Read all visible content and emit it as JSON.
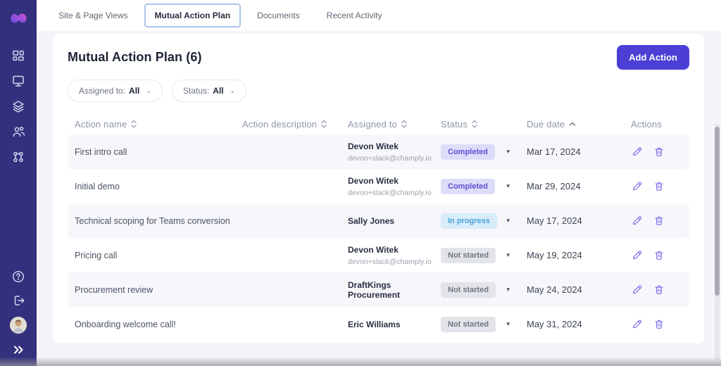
{
  "colors": {
    "sidebar": "#33317d",
    "accent": "#4b3fd6",
    "active_tab_border": "#a9c3ea",
    "row_alt_bg": "#f6f6fb",
    "completed_bg": "#dcddf8",
    "completed_text": "#5a50d6",
    "in_progress_bg": "#d8ecf9",
    "in_progress_text": "#49a3dc",
    "not_started_bg": "#e3e4e9",
    "not_started_text": "#6e7580",
    "action_icon": "#7a6ee8"
  },
  "sidebar": {
    "icons": [
      "app-logo",
      "dashboard-icon",
      "monitor-icon",
      "layers-icon",
      "users-icon",
      "nodes-icon",
      "help-icon",
      "logout-icon",
      "user-avatar",
      "expand-icon"
    ]
  },
  "tabs": [
    {
      "label": "Site & Page Views",
      "active": false
    },
    {
      "label": "Mutual Action Plan",
      "active": true
    },
    {
      "label": "Documents",
      "active": false
    },
    {
      "label": "Recent Activity",
      "active": false
    }
  ],
  "header": {
    "title": "Mutual Action Plan (6)",
    "add_button": "Add Action"
  },
  "filters": {
    "assigned_label": "Assigned to:",
    "assigned_value": "All",
    "status_label": "Status:",
    "status_value": "All"
  },
  "table": {
    "columns": [
      {
        "label": "Action name",
        "sort": "both"
      },
      {
        "label": "Action description",
        "sort": "both"
      },
      {
        "label": "Assigned to",
        "sort": "both"
      },
      {
        "label": "Status",
        "sort": "both"
      },
      {
        "label": "Due date",
        "sort": "asc"
      },
      {
        "label": "Actions",
        "sort": "none"
      }
    ],
    "rows": [
      {
        "name": "First intro call",
        "description": "",
        "assignee": "Devon Witek",
        "assignee_email": "devon+slack@champly.io",
        "status": "Completed",
        "due": "Mar 17, 2024"
      },
      {
        "name": "Initial demo",
        "description": "",
        "assignee": "Devon Witek",
        "assignee_email": "devon+slack@champly.io",
        "status": "Completed",
        "due": "Mar 29, 2024"
      },
      {
        "name": "Technical scoping for Teams conversion",
        "description": "",
        "assignee": "Sally Jones",
        "assignee_email": "",
        "status": "In progress",
        "due": "May 17, 2024"
      },
      {
        "name": "Pricing call",
        "description": "",
        "assignee": "Devon Witek",
        "assignee_email": "devon+slack@champly.io",
        "status": "Not started",
        "due": "May 19, 2024"
      },
      {
        "name": "Procurement review",
        "description": "",
        "assignee": "DraftKings Procurement",
        "assignee_email": "",
        "status": "Not started",
        "due": "May 24, 2024"
      },
      {
        "name": "Onboarding welcome call!",
        "description": "",
        "assignee": "Eric Williams",
        "assignee_email": "",
        "status": "Not started",
        "due": "May 31, 2024"
      }
    ]
  }
}
